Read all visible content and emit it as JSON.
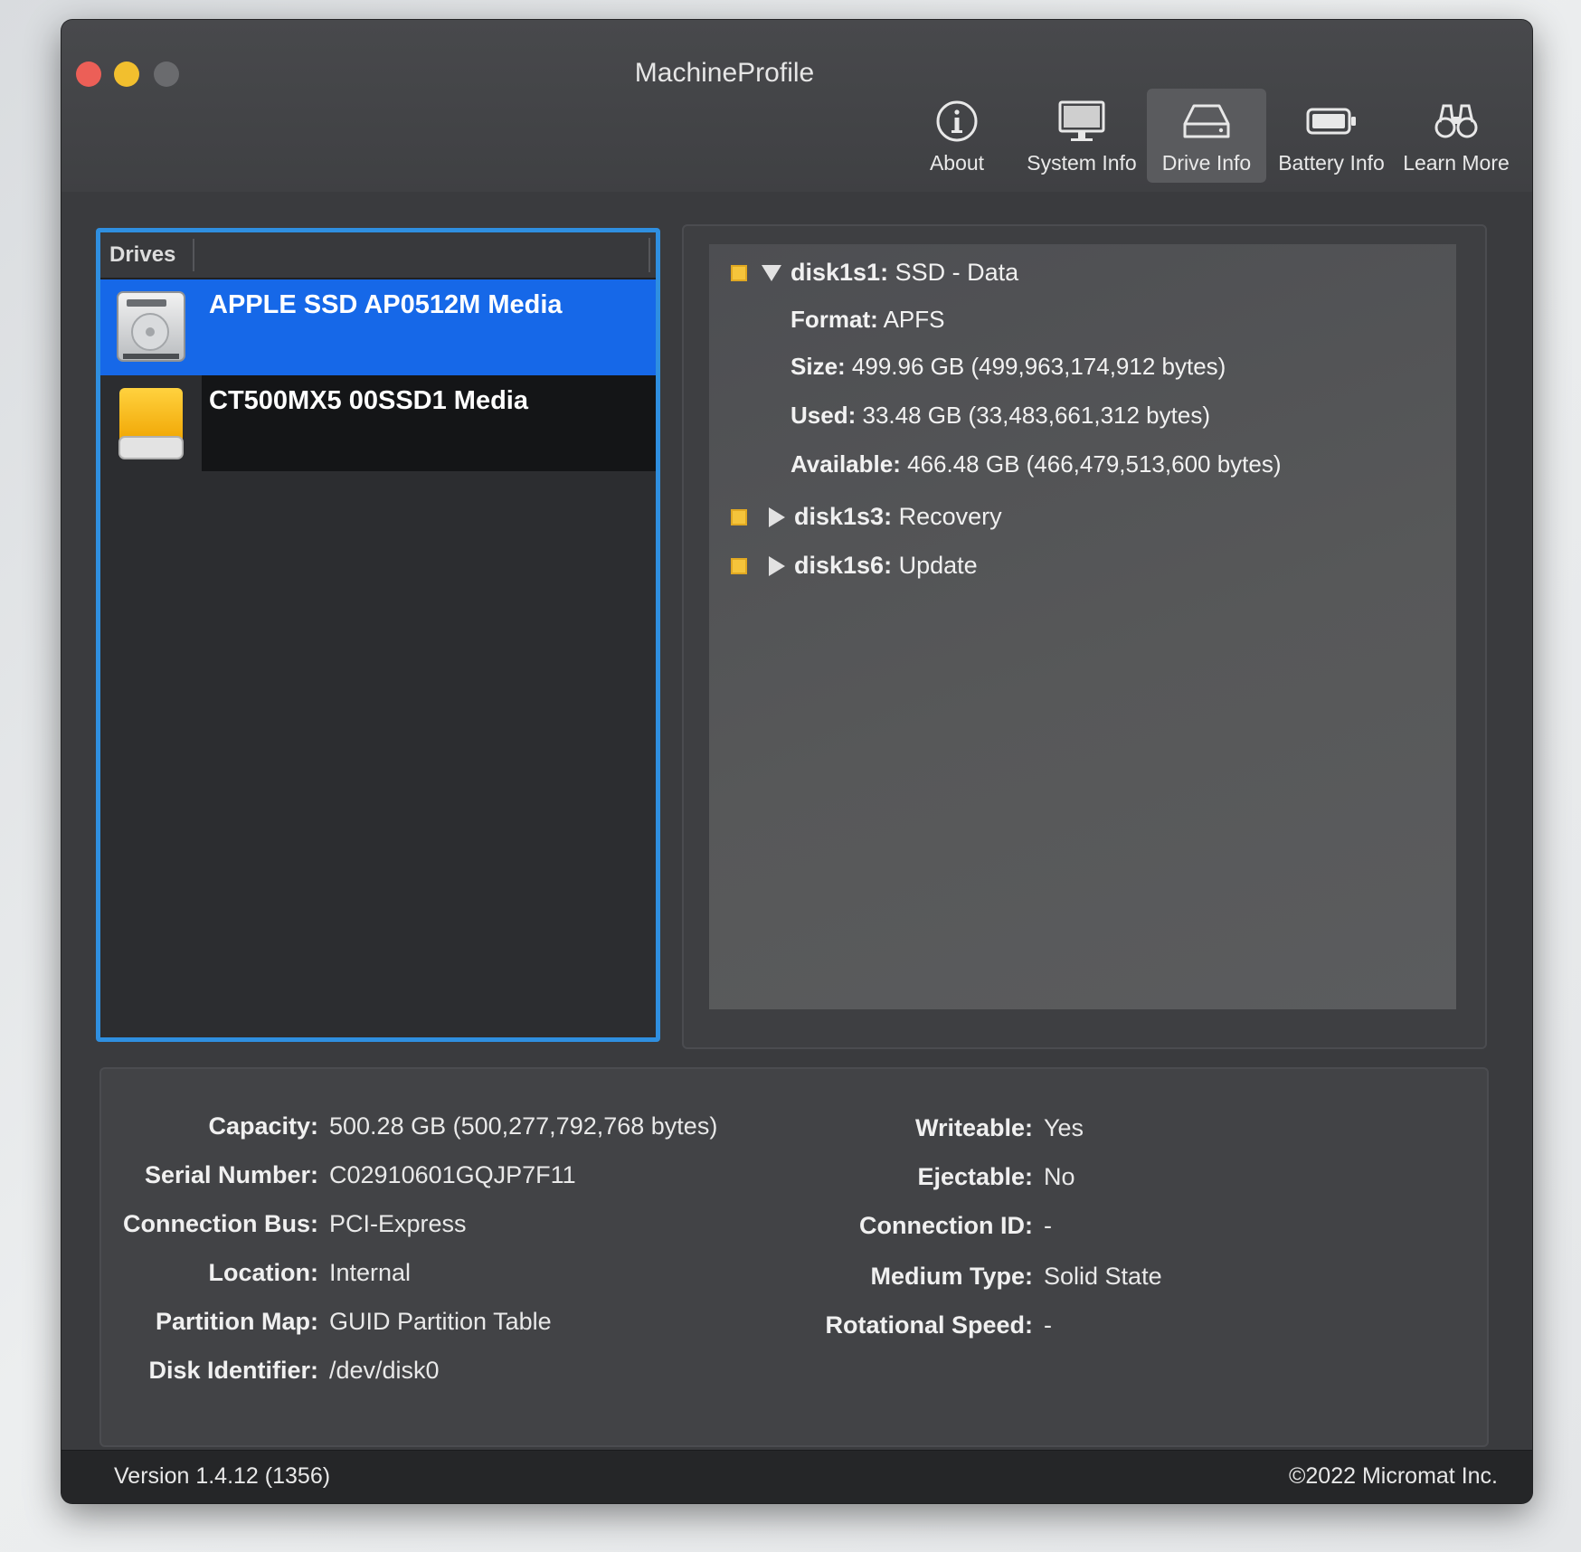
{
  "window": {
    "title": "MachineProfile"
  },
  "toolbar": {
    "items": [
      {
        "label": "About",
        "icon": "info-circle-icon",
        "active": false
      },
      {
        "label": "System Info",
        "icon": "monitor-icon",
        "active": false
      },
      {
        "label": "Drive Info",
        "icon": "drive-icon",
        "active": true
      },
      {
        "label": "Battery Info",
        "icon": "battery-icon",
        "active": false
      },
      {
        "label": "Learn More",
        "icon": "binoculars-icon",
        "active": false
      }
    ]
  },
  "drives": {
    "header": "Drives",
    "items": [
      {
        "name": "APPLE SSD AP0512M Media",
        "icon": "internal-disk-icon",
        "selected": true
      },
      {
        "name": "CT500MX5 00SSD1 Media",
        "icon": "external-disk-icon",
        "selected": false
      }
    ]
  },
  "partitions": {
    "expanded": {
      "id": "disk1s1:",
      "name": "SSD - Data",
      "details": [
        {
          "label": "Format:",
          "value": "APFS"
        },
        {
          "label": "Size:",
          "value": "499.96 GB (499,963,174,912 bytes)"
        },
        {
          "label": "Used:",
          "value": "33.48 GB (33,483,661,312 bytes)"
        },
        {
          "label": "Available:",
          "value": "466.48 GB (466,479,513,600 bytes)"
        }
      ]
    },
    "collapsed": [
      {
        "id": "disk1s3:",
        "name": "Recovery"
      },
      {
        "id": "disk1s6:",
        "name": "Update"
      }
    ]
  },
  "drive_info": {
    "left": [
      {
        "label": "Capacity:",
        "value": "500.28 GB (500,277,792,768 bytes)"
      },
      {
        "label": "Serial Number:",
        "value": "C02910601GQJP7F11"
      },
      {
        "label": "Connection Bus:",
        "value": "PCI-Express"
      },
      {
        "label": "Location:",
        "value": "Internal"
      },
      {
        "label": "Partition Map:",
        "value": "GUID Partition Table"
      },
      {
        "label": "Disk Identifier:",
        "value": "/dev/disk0"
      }
    ],
    "right": [
      {
        "label": "Writeable:",
        "value": "Yes"
      },
      {
        "label": "Ejectable:",
        "value": "No"
      },
      {
        "label": "Connection ID:",
        "value": "-"
      },
      {
        "label": "Medium Type:",
        "value": "Solid State"
      },
      {
        "label": "Rotational Speed:",
        "value": "-"
      }
    ]
  },
  "status": {
    "version": "Version 1.4.12 (1356)",
    "copyright": "©2022 Micromat Inc."
  },
  "colors": {
    "selection": "#1668e8",
    "focus_ring": "#2f8fe0",
    "partition_marker": "#f5c43b"
  }
}
